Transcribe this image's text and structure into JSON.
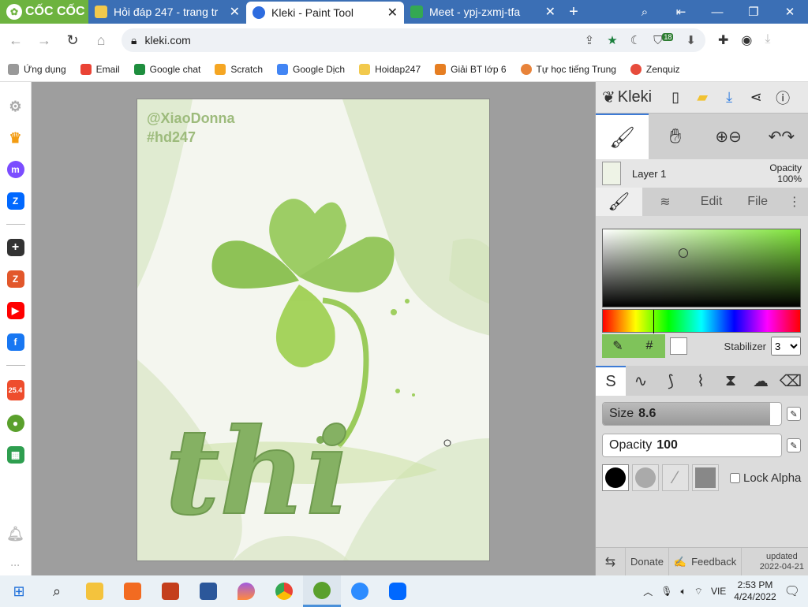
{
  "browser": {
    "brand": "CỐC CỐC",
    "tabs": [
      {
        "title": "Hỏi đáp 247 - trang tr",
        "color": "#f2c94c"
      },
      {
        "title": "Kleki - Paint Tool",
        "color": "#2d6cdf"
      },
      {
        "title": "Meet - ypj-zxmj-tfa",
        "color": "#34a853"
      }
    ],
    "url": "kleki.com",
    "badge": "18"
  },
  "bookmarks": [
    {
      "label": "Ứng dụng",
      "color": "#999999"
    },
    {
      "label": "Email",
      "color": "#ea4335"
    },
    {
      "label": "Google chat",
      "color": "#1e8e3e"
    },
    {
      "label": "Scratch",
      "color": "#f5a623"
    },
    {
      "label": "Google Dịch",
      "color": "#4285f4"
    },
    {
      "label": "Hoidap247",
      "color": "#f2c94c"
    },
    {
      "label": "Giải BT lớp 6",
      "color": "#e67e22"
    },
    {
      "label": "Tự học tiếng Trung",
      "color": "#e8833a"
    },
    {
      "label": "Zenquiz",
      "color": "#e74c3c"
    }
  ],
  "sidebar_badge": "25.4",
  "canvas": {
    "handle": "@XiaoDonna",
    "tag": "#hd247",
    "word": "thi"
  },
  "panel": {
    "brand": "Kleki",
    "layer_name": "Layer 1",
    "opacity_label": "Opacity",
    "opacity_value": "100%",
    "tab_edit": "Edit",
    "tab_file": "File",
    "hash": "#",
    "stabilizer_label": "Stabilizer",
    "stabilizer_value": "3",
    "size_label": "Size",
    "size_value": "8.6",
    "size_fill": 0.94,
    "brush_opacity_label": "Opacity",
    "brush_opacity_value": "100",
    "brush_opacity_fill": 1.0,
    "lock_alpha": "Lock Alpha",
    "donate": "Donate",
    "feedback": "Feedback",
    "updated_label": "updated",
    "updated_date": "2022-04-21"
  },
  "taskbar": {
    "lang": "VIE",
    "time": "2:53 PM",
    "date": "4/24/2022"
  }
}
